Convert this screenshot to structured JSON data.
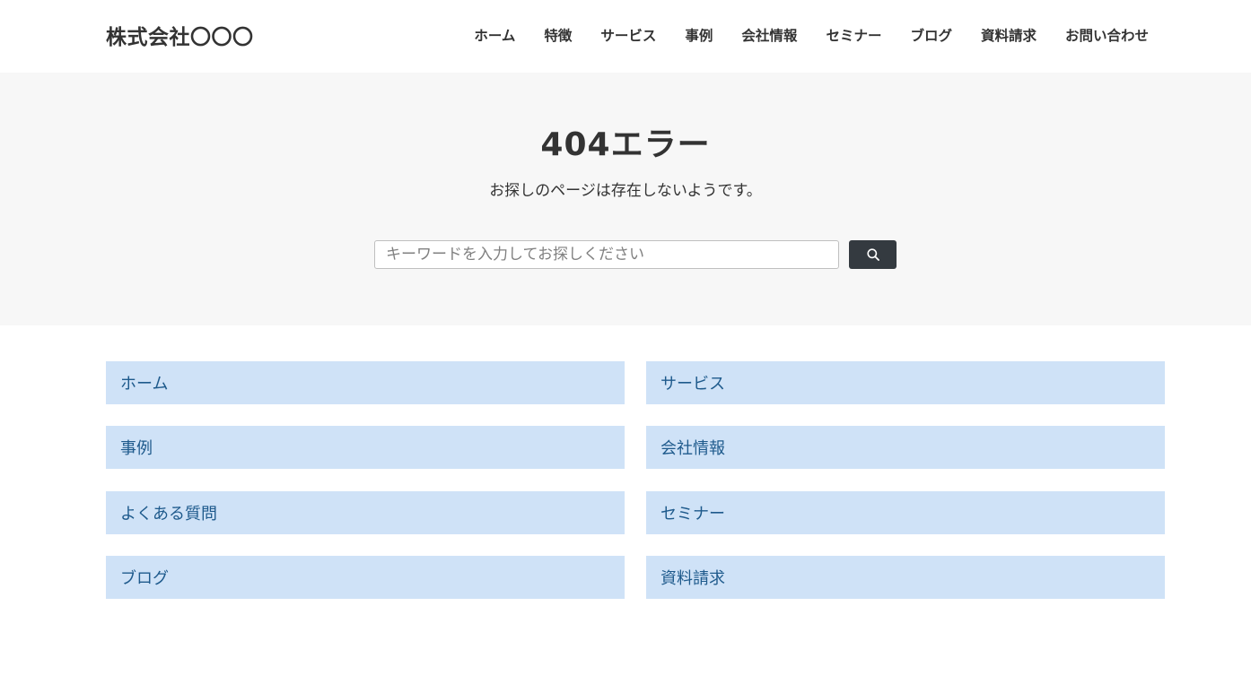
{
  "header": {
    "logo": "株式会社〇〇〇",
    "nav": [
      {
        "label": "ホーム"
      },
      {
        "label": "特徴"
      },
      {
        "label": "サービス"
      },
      {
        "label": "事例"
      },
      {
        "label": "会社情報"
      },
      {
        "label": "セミナー"
      },
      {
        "label": "ブログ"
      },
      {
        "label": "資料請求"
      },
      {
        "label": "お問い合わせ"
      }
    ]
  },
  "hero": {
    "title": "404エラー",
    "message": "お探しのページは存在しないようです。",
    "search": {
      "placeholder": "キーワードを入力してお探しください",
      "value": "",
      "button_icon": "search-icon"
    }
  },
  "links": [
    {
      "label": "ホーム"
    },
    {
      "label": "サービス"
    },
    {
      "label": "事例"
    },
    {
      "label": "会社情報"
    },
    {
      "label": "よくある質問"
    },
    {
      "label": "セミナー"
    },
    {
      "label": "ブログ"
    },
    {
      "label": "資料請求"
    }
  ],
  "colors": {
    "hero_bg": "#f7f7f7",
    "link_bg": "#cfe2f7",
    "link_text": "#1e5a8c",
    "search_button_bg": "#343a40",
    "text": "#333333"
  }
}
